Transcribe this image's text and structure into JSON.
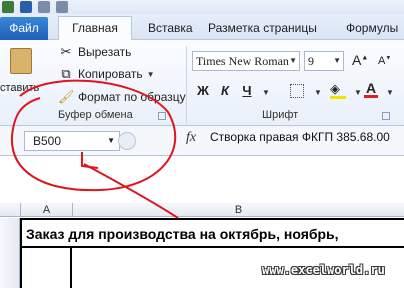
{
  "ribbon_tabs": {
    "file": "Файл",
    "home": "Главная",
    "insert": "Вставка",
    "layout": "Разметка страницы",
    "formulas": "Формулы"
  },
  "clipboard": {
    "paste_label": "ставить",
    "cut": "Вырезать",
    "copy": "Копировать",
    "format_painter": "Формат по образцу",
    "group_label": "Буфер обмена"
  },
  "font": {
    "family": "Times New Roman",
    "size": "9",
    "group_label": "Шрифт",
    "bold": "Ж",
    "italic": "К",
    "underline": "Ч",
    "font_color_letter": "А"
  },
  "formula_bar": {
    "name_box": "B500",
    "fx_label": "fx",
    "content": "Створка правая ФКГП 385.68.00"
  },
  "grid": {
    "col_a": "A",
    "col_b": "B",
    "title_cell": "Заказ для производства на октябрь, ноябрь,"
  },
  "watermark": "www.excelworld.ru",
  "colors": {
    "file_tab": "#2a74cc",
    "annotation": "#e0141e",
    "font_color_bar": "#e02020",
    "fill_color_bar": "#f2e400"
  }
}
